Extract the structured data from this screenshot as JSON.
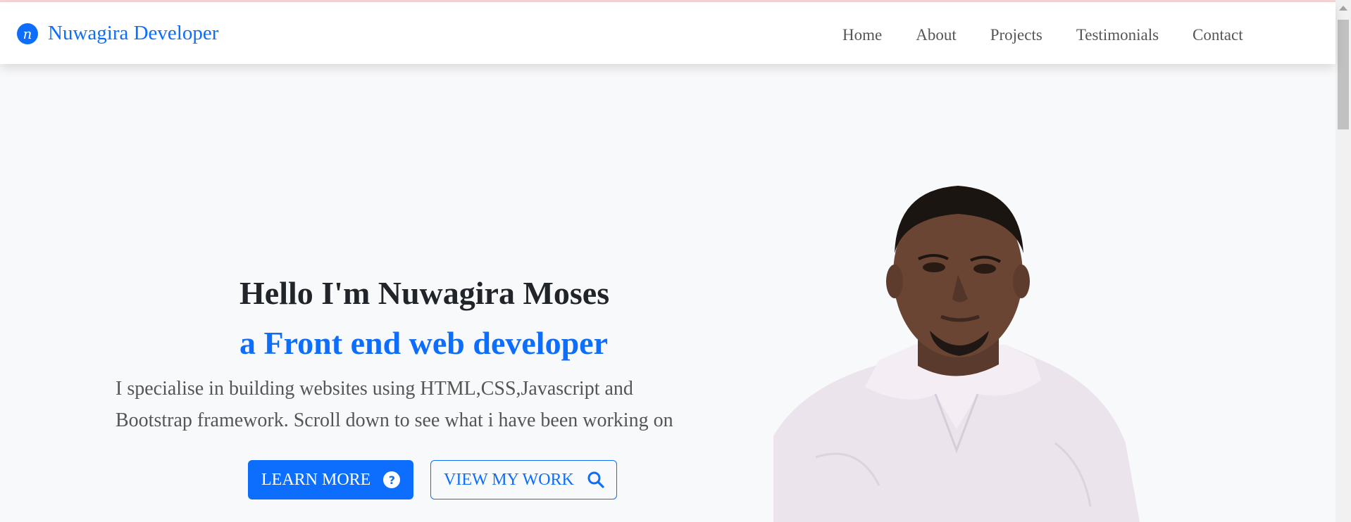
{
  "brand": {
    "logo_letter": "n",
    "name": "Nuwagira Developer"
  },
  "nav": {
    "items": [
      {
        "label": "Home"
      },
      {
        "label": "About"
      },
      {
        "label": "Projects"
      },
      {
        "label": "Testimonials"
      },
      {
        "label": "Contact"
      }
    ]
  },
  "hero": {
    "title": "Hello I'm Nuwagira Moses",
    "subtitle": "a Front end web developer",
    "description_line1": "I specialise in building websites using HTML,CSS,Javascript and",
    "description_line2": "Bootstrap framework. Scroll down to see what i have been working on",
    "learn_more_label": "LEARN MORE",
    "learn_more_icon": "question-circle-icon",
    "view_work_label": "VIEW MY WORK",
    "view_work_icon": "search-icon"
  },
  "colors": {
    "accent": "#0d6efd",
    "background": "#f8f9fa",
    "heading": "#212529",
    "text": "#555555"
  }
}
